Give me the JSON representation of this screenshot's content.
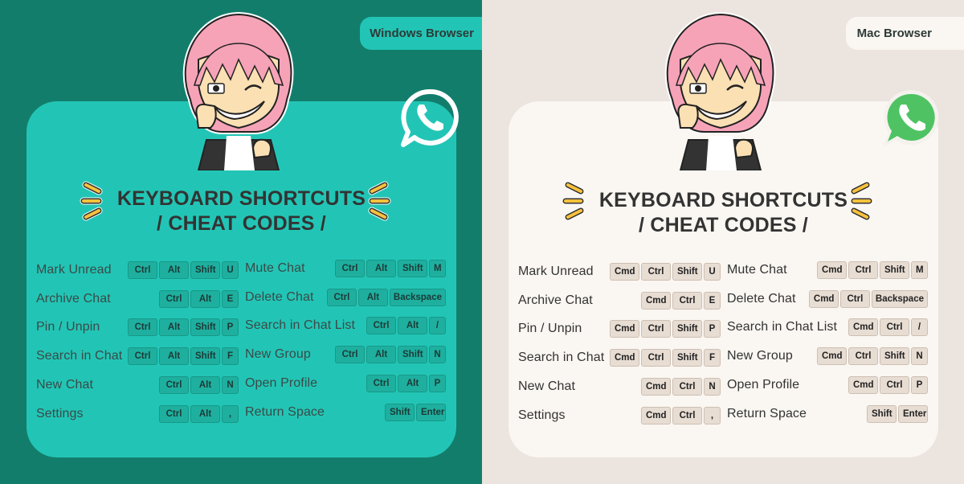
{
  "panels": [
    {
      "id": "windows",
      "badge": "Windows Browser",
      "title_line1": "KEYBOARD SHORTCUTS",
      "title_line2": "/ CHEAT CODES /",
      "icon": "whatsapp-outline-icon",
      "colors": {
        "background": "#137d6c",
        "card": "#22c5b5",
        "key": "#1eaf9f"
      },
      "left_column": [
        {
          "label": "Mark Unread",
          "keys": [
            "Ctrl",
            "Alt",
            "Shift",
            "U"
          ]
        },
        {
          "label": "Archive Chat",
          "keys": [
            "Ctrl",
            "Alt",
            "E"
          ]
        },
        {
          "label": "Pin / Unpin",
          "keys": [
            "Ctrl",
            "Alt",
            "Shift",
            "P"
          ]
        },
        {
          "label": "Search in Chat",
          "keys": [
            "Ctrl",
            "Alt",
            "Shift",
            "F"
          ]
        },
        {
          "label": "New Chat",
          "keys": [
            "Ctrl",
            "Alt",
            "N"
          ]
        },
        {
          "label": "Settings",
          "keys": [
            "Ctrl",
            "Alt",
            ","
          ]
        }
      ],
      "right_column": [
        {
          "label": "Mute Chat",
          "keys": [
            "Ctrl",
            "Alt",
            "Shift",
            "M"
          ]
        },
        {
          "label": "Delete Chat",
          "keys": [
            "Ctrl",
            "Alt",
            "Backspace"
          ]
        },
        {
          "label": "Search in Chat List",
          "keys": [
            "Ctrl",
            "Alt",
            "/"
          ]
        },
        {
          "label": "New Group",
          "keys": [
            "Ctrl",
            "Alt",
            "Shift",
            "N"
          ]
        },
        {
          "label": "Open Profile",
          "keys": [
            "Ctrl",
            "Alt",
            "P"
          ]
        },
        {
          "label": "Return Space",
          "keys": [
            "Shift",
            "Enter"
          ]
        }
      ]
    },
    {
      "id": "mac",
      "badge": "Mac Browser",
      "title_line1": "KEYBOARD SHORTCUTS",
      "title_line2": "/ CHEAT CODES /",
      "icon": "whatsapp-green-icon",
      "colors": {
        "background": "#ece4de",
        "card": "#faf6f2",
        "key": "#e8ddd3"
      },
      "left_column": [
        {
          "label": "Mark Unread",
          "keys": [
            "Cmd",
            "Ctrl",
            "Shift",
            "U"
          ]
        },
        {
          "label": "Archive Chat",
          "keys": [
            "Cmd",
            "Ctrl",
            "E"
          ]
        },
        {
          "label": "Pin / Unpin",
          "keys": [
            "Cmd",
            "Ctrl",
            "Shift",
            "P"
          ]
        },
        {
          "label": "Search in Chat",
          "keys": [
            "Cmd",
            "Ctrl",
            "Shift",
            "F"
          ]
        },
        {
          "label": "New Chat",
          "keys": [
            "Cmd",
            "Ctrl",
            "N"
          ]
        },
        {
          "label": "Settings",
          "keys": [
            "Cmd",
            "Ctrl",
            ","
          ]
        }
      ],
      "right_column": [
        {
          "label": "Mute Chat",
          "keys": [
            "Cmd",
            "Ctrl",
            "Shift",
            "M"
          ]
        },
        {
          "label": "Delete Chat",
          "keys": [
            "Cmd",
            "Ctrl",
            "Backspace"
          ]
        },
        {
          "label": "Search in Chat List",
          "keys": [
            "Cmd",
            "Ctrl",
            "/"
          ]
        },
        {
          "label": "New Group",
          "keys": [
            "Cmd",
            "Ctrl",
            "Shift",
            "N"
          ]
        },
        {
          "label": "Open Profile",
          "keys": [
            "Cmd",
            "Ctrl",
            "P"
          ]
        },
        {
          "label": "Return Space",
          "keys": [
            "Shift",
            "Enter"
          ]
        }
      ]
    }
  ]
}
